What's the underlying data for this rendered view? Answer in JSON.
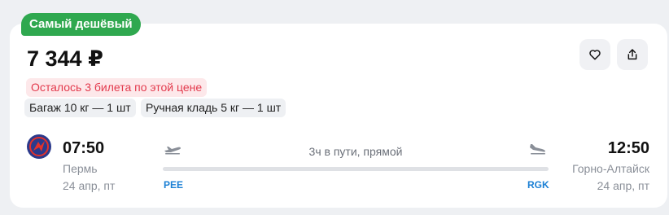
{
  "offer": {
    "badge": "Самый дешёвый",
    "price": "7 344 ₽",
    "tickets_left": "Осталось 3 билета по этой цене",
    "baggage": "Багаж 10 кг — 1 шт",
    "hand_luggage": "Ручная кладь 5 кг — 1 шт"
  },
  "actions": {
    "favorite_icon": "heart-icon",
    "share_icon": "share-icon"
  },
  "flight": {
    "airline_logo_icon": "airline-logo",
    "departure": {
      "time": "07:50",
      "city": "Пермь",
      "date": "24 апр, пт",
      "iata": "PEE"
    },
    "arrival": {
      "time": "12:50",
      "city": "Горно-Алтайск",
      "date": "24 апр, пт",
      "iata": "RGK"
    },
    "duration": "3ч в пути, прямой"
  },
  "colors": {
    "badge_green": "#2fa84f",
    "warning_red": "#e33a4d",
    "link_blue": "#1a7fd4"
  }
}
